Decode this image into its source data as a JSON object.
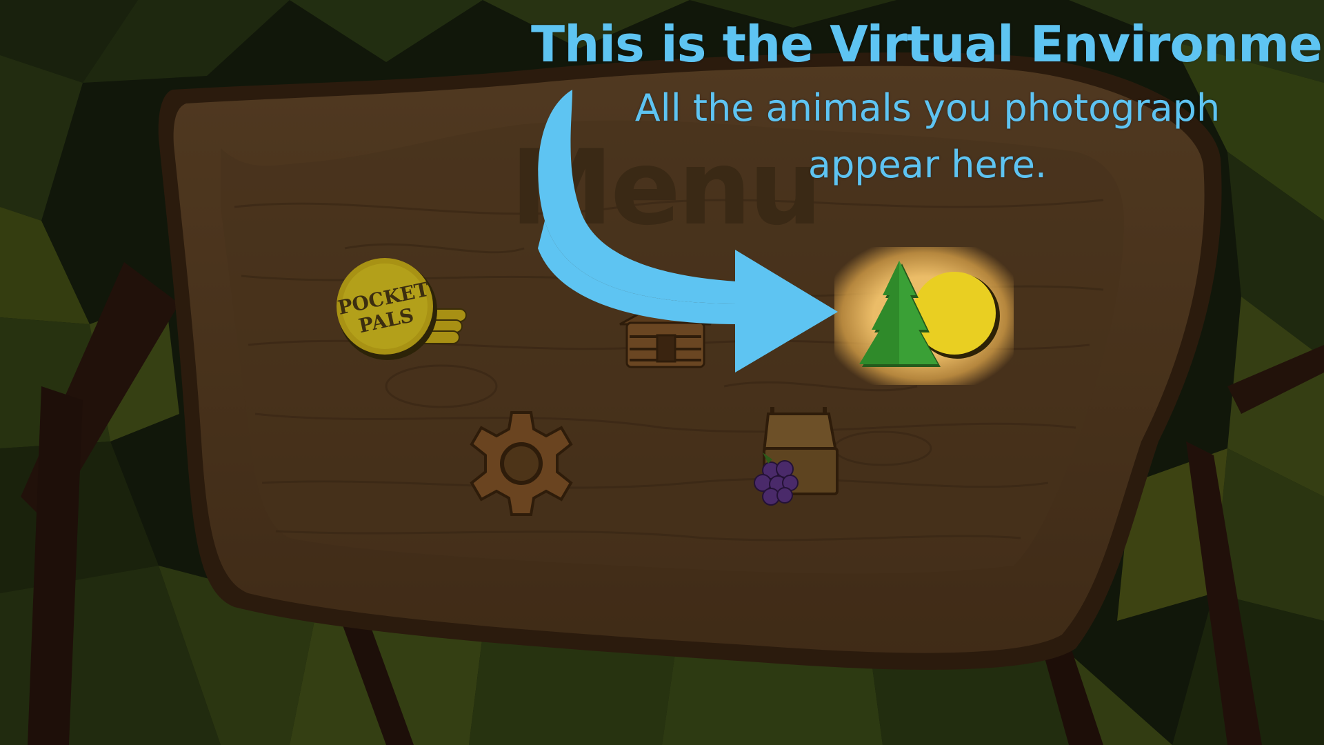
{
  "tutorial": {
    "title": "This is the Virtual Environment.",
    "body": "All the animals you photograph appear here."
  },
  "menu": {
    "title": "Menu",
    "buttons": [
      {
        "id": "store",
        "icon": "pocket-pals-coin-icon",
        "logo_text": "POCKET PALS"
      },
      {
        "id": "cabin",
        "icon": "log-cabin-icon"
      },
      {
        "id": "environment",
        "icon": "pine-tree-sun-icon",
        "highlighted": true
      },
      {
        "id": "settings",
        "icon": "gear-icon"
      },
      {
        "id": "food",
        "icon": "basket-berries-icon"
      }
    ]
  },
  "colors": {
    "tutorial_text": "#5ec4f2",
    "arrow": "#5ec4f2",
    "wood": "#8a6238",
    "highlight": "#f4c46c"
  }
}
